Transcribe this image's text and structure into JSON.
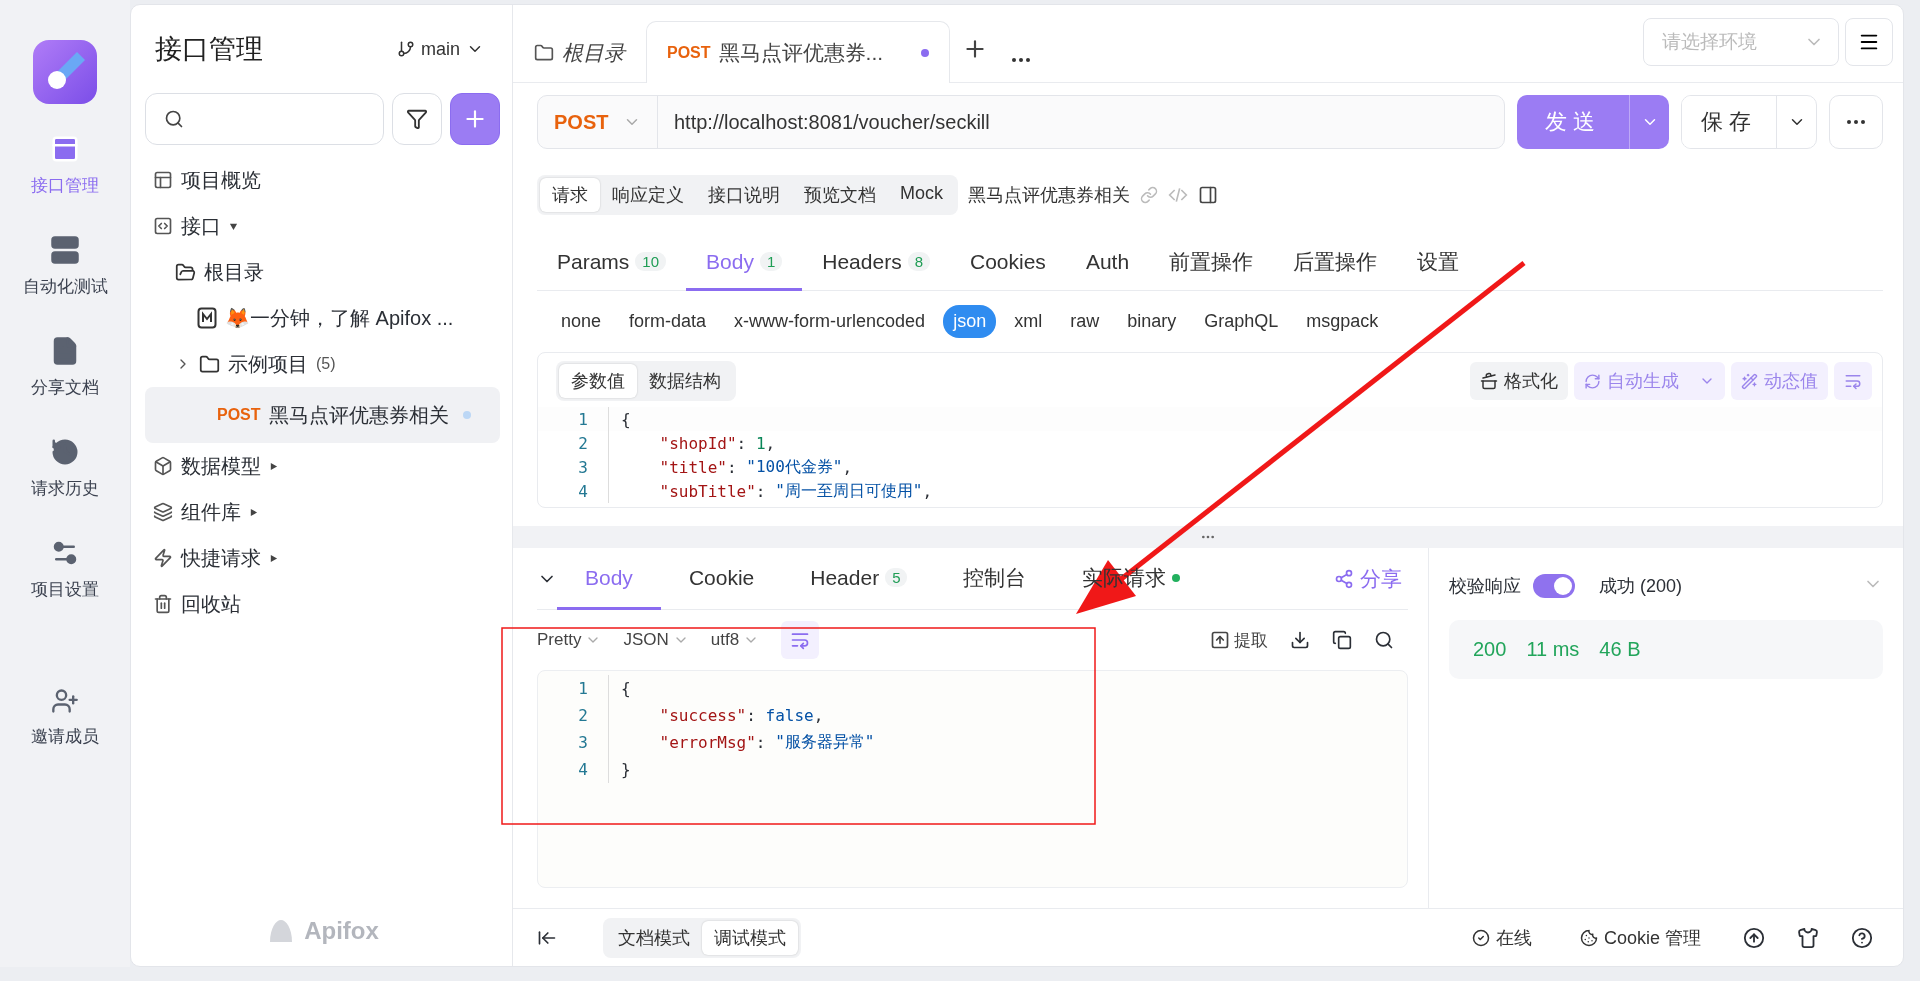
{
  "rail": {
    "items": [
      {
        "label": "接口管理",
        "selected": true
      },
      {
        "label": "自动化测试",
        "selected": false
      },
      {
        "label": "分享文档",
        "selected": false
      },
      {
        "label": "请求历史",
        "selected": false
      },
      {
        "label": "项目设置",
        "selected": false
      }
    ],
    "invite": "邀请成员"
  },
  "sidebar": {
    "title": "接口管理",
    "branch": "main",
    "brand": "Apifox",
    "tree": [
      {
        "kind": "overview",
        "label": "项目概览",
        "selected": false
      },
      {
        "kind": "section",
        "label": "接口",
        "expanded": true,
        "selected": false,
        "children": [
          {
            "kind": "folder",
            "label": "根目录",
            "expanded": true,
            "selected": false,
            "children": [
              {
                "kind": "doc",
                "label": "🦊一分钟，了解 Apifox ...",
                "selected": false
              },
              {
                "kind": "folder",
                "label": "示例项目",
                "count": "(5)",
                "expanded": false,
                "selected": false
              },
              {
                "kind": "api",
                "method": "POST",
                "label": "黑马点评优惠券相关",
                "modified": true,
                "selected": true
              }
            ]
          }
        ]
      },
      {
        "kind": "section",
        "label": "数据模型",
        "expanded": false,
        "selected": false
      },
      {
        "kind": "section",
        "label": "组件库",
        "expanded": false,
        "selected": false
      },
      {
        "kind": "section",
        "label": "快捷请求",
        "expanded": false,
        "selected": false
      },
      {
        "kind": "trash",
        "label": "回收站",
        "selected": false
      }
    ]
  },
  "tabs": [
    {
      "kind": "folder",
      "label": "根目录",
      "selected": false
    },
    {
      "kind": "api",
      "method": "POST",
      "label": "黑马点评优惠券...",
      "modified": true,
      "selected": true
    }
  ],
  "environment": {
    "placeholder": "请选择环境"
  },
  "request": {
    "method": "POST",
    "url": "http://localhost:8081/voucher/seckill",
    "send": "发送",
    "save": "保存"
  },
  "views": [
    {
      "label": "请求",
      "selected": true
    },
    {
      "label": "响应定义",
      "selected": false
    },
    {
      "label": "接口说明",
      "selected": false
    },
    {
      "label": "预览文档",
      "selected": false
    },
    {
      "label": "Mock",
      "selected": false
    }
  ],
  "api_name": "黑马点评优惠券相关",
  "param_tabs": [
    {
      "label": "Params",
      "count": "10",
      "selected": false
    },
    {
      "label": "Body",
      "count": "1",
      "selected": true
    },
    {
      "label": "Headers",
      "count": "8",
      "selected": false
    },
    {
      "label": "Cookies",
      "selected": false
    },
    {
      "label": "Auth",
      "selected": false
    },
    {
      "label": "前置操作",
      "selected": false
    },
    {
      "label": "后置操作",
      "selected": false
    },
    {
      "label": "设置",
      "selected": false
    }
  ],
  "body_types": [
    {
      "label": "none",
      "selected": false
    },
    {
      "label": "form-data",
      "selected": false
    },
    {
      "label": "x-www-form-urlencoded",
      "selected": false
    },
    {
      "label": "json",
      "selected": true
    },
    {
      "label": "xml",
      "selected": false
    },
    {
      "label": "raw",
      "selected": false
    },
    {
      "label": "binary",
      "selected": false
    },
    {
      "label": "GraphQL",
      "selected": false
    },
    {
      "label": "msgpack",
      "selected": false
    }
  ],
  "editor": {
    "modes": [
      {
        "label": "参数值",
        "selected": true
      },
      {
        "label": "数据结构",
        "selected": false
      }
    ],
    "format": "格式化",
    "generate": "自动生成",
    "dynamic": "动态值",
    "lines": [
      {
        "no": "1",
        "code": "{"
      },
      {
        "no": "2",
        "code": "    \"shopId\": 1,"
      },
      {
        "no": "3",
        "code": "    \"title\": \"100代金券\","
      },
      {
        "no": "4",
        "code": "    \"subTitle\": \"周一至周日可使用\","
      }
    ]
  },
  "response": {
    "tabs": [
      {
        "label": "Body",
        "selected": true
      },
      {
        "label": "Cookie",
        "selected": false
      },
      {
        "label": "Header",
        "count": "5",
        "selected": false
      },
      {
        "label": "控制台",
        "selected": false
      },
      {
        "label": "实际请求",
        "live": true,
        "selected": false
      }
    ],
    "share": "分享",
    "formats": [
      "Pretty",
      "JSON",
      "utf8"
    ],
    "extract": "提取",
    "lines": [
      {
        "no": "1",
        "code": "{"
      },
      {
        "no": "2",
        "code": "    \"success\": false,"
      },
      {
        "no": "3",
        "code": "    \"errorMsg\": \"服务器异常\""
      },
      {
        "no": "4",
        "code": "}"
      }
    ],
    "validate": {
      "label": "校验响应",
      "on": true,
      "result": "成功 (200)"
    },
    "stats": [
      "200",
      "11 ms",
      "46 B"
    ]
  },
  "footer": {
    "modes": [
      {
        "label": "文档模式",
        "selected": false
      },
      {
        "label": "调试模式",
        "selected": true
      }
    ],
    "online": "在线",
    "cookies": "Cookie 管理"
  },
  "annotation": {
    "arrow": true,
    "frame": true
  }
}
